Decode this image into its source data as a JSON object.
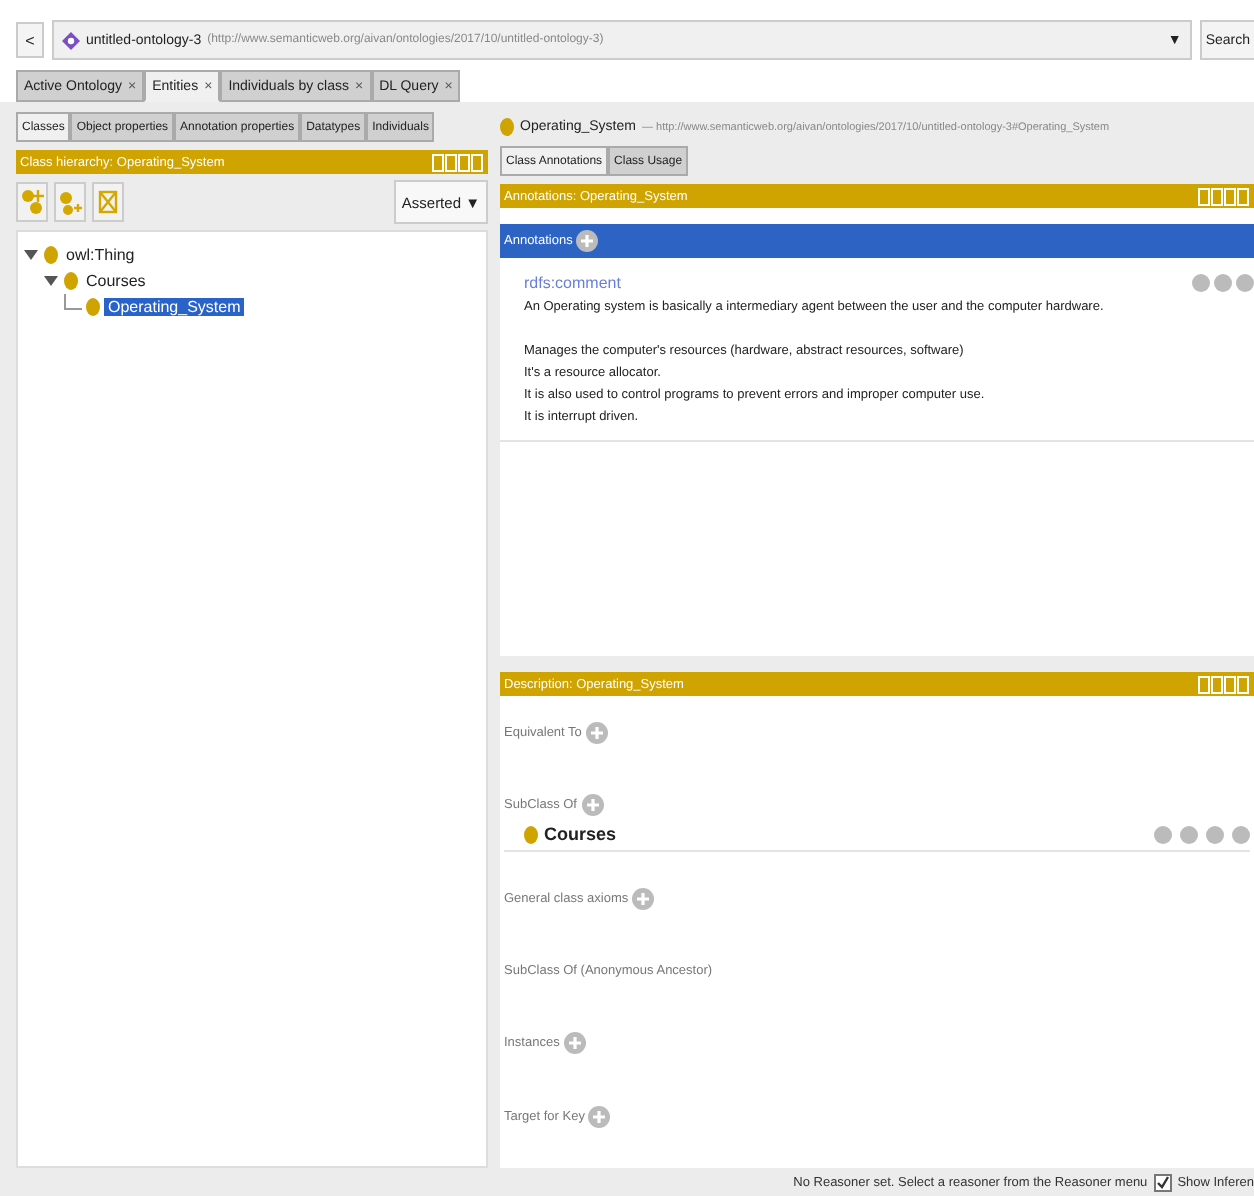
{
  "address_bar": {
    "back": "<",
    "ontology": "untitled-ontology-3",
    "iri": "(http://www.semanticweb.org/aivan/ontologies/2017/10/untitled-ontology-3)",
    "dropdown": "▼",
    "search": "Search"
  },
  "tabs": [
    {
      "label": "Active Ontology",
      "close": "×",
      "selected": false
    },
    {
      "label": "Entities",
      "close": "×",
      "selected": true
    },
    {
      "label": "Individuals by class",
      "close": "×",
      "selected": false
    },
    {
      "label": "DL Query",
      "close": "×",
      "selected": false
    }
  ],
  "left": {
    "subtabs": [
      {
        "label": "Classes",
        "selected": true
      },
      {
        "label": "Object properties",
        "selected": false
      },
      {
        "label": "Annotation properties",
        "selected": false
      },
      {
        "label": "Datatypes",
        "selected": false
      },
      {
        "label": "Individuals",
        "selected": false
      }
    ],
    "header": "Class hierarchy: Operating_System",
    "mode": "Asserted",
    "mode_arrow": "▼",
    "tree": [
      {
        "label": "owl:Thing",
        "expanded": true,
        "selected": false,
        "children": [
          {
            "label": "Courses",
            "expanded": true,
            "selected": false,
            "children": [
              {
                "label": "Operating_System",
                "selected": true
              }
            ]
          }
        ]
      }
    ]
  },
  "right": {
    "entity": "Operating_System",
    "entity_iri": "— http://www.semanticweb.org/aivan/ontologies/2017/10/untitled-ontology-3#Operating_System",
    "tabs": [
      {
        "label": "Class Annotations",
        "selected": true
      },
      {
        "label": "Class Usage",
        "selected": false
      }
    ],
    "annotations_header": "Annotations: Operating_System",
    "annotations_label": "Annotations",
    "annotation": {
      "property": "rdfs:comment",
      "paragraphs": [
        [
          "An Operating system is basically a intermediary agent between the user and the computer hardware."
        ],
        [
          "Manages the computer's resources (hardware, abstract resources, software)",
          "It's a resource allocator.",
          "It is also used to control programs to prevent errors and improper computer use.",
          "It is interrupt driven."
        ]
      ]
    },
    "description_header": "Description: Operating_System",
    "sections": [
      {
        "label": "Equivalent To",
        "addable": true
      },
      {
        "label": "SubClass Of",
        "addable": true,
        "items": [
          "Courses"
        ]
      },
      {
        "label": "General class axioms",
        "addable": true
      },
      {
        "label": "SubClass Of (Anonymous Ancestor)",
        "addable": false
      },
      {
        "label": "Instances",
        "addable": true
      },
      {
        "label": "Target for Key",
        "addable": true
      }
    ]
  },
  "status_bar": {
    "message": "No Reasoner set. Select a reasoner from the Reasoner menu",
    "checkbox_label": "Show Inferen",
    "checked": true
  }
}
